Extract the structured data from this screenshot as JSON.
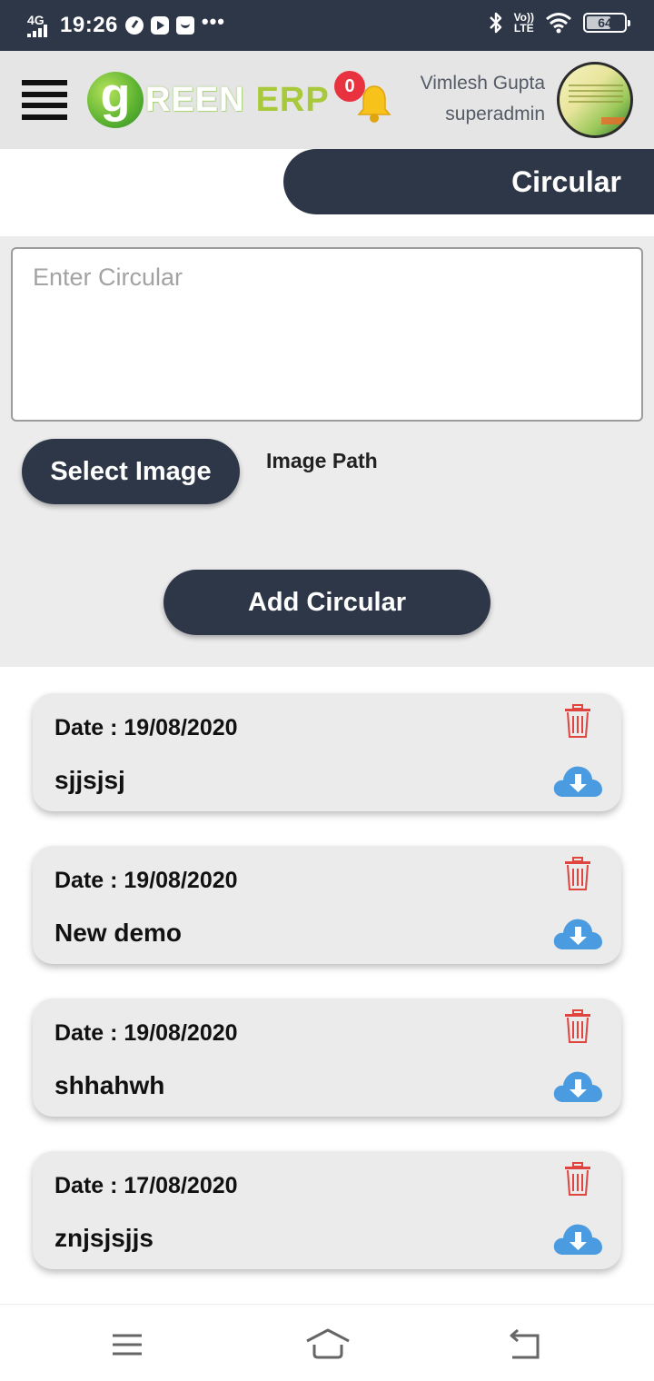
{
  "status_bar": {
    "network": "4G",
    "time": "19:26",
    "more": "•••",
    "volte_top": "Vo))",
    "volte_bottom": "LTE",
    "battery": "64",
    "battery_level_percent": 64
  },
  "header": {
    "logo_g": "g",
    "logo_reen": "REEN",
    "logo_erp": "ERP",
    "notification_count": "0",
    "user_name": "Vimlesh Gupta",
    "user_role": "superadmin"
  },
  "page": {
    "title": "Circular"
  },
  "form": {
    "circular_placeholder": "Enter Circular",
    "circular_value": "",
    "select_image_label": "Select Image",
    "image_path_label": "Image Path",
    "add_button_label": "Add Circular"
  },
  "circulars": [
    {
      "date": "Date : 19/08/2020",
      "title": "sjjsjsj"
    },
    {
      "date": "Date : 19/08/2020",
      "title": "New demo"
    },
    {
      "date": "Date : 19/08/2020",
      "title": "shhahwh"
    },
    {
      "date": "Date : 17/08/2020",
      "title": "znjsjsjjs"
    }
  ],
  "colors": {
    "primary_dark": "#2e3748",
    "badge_red": "#e8323f",
    "trash_red": "#e0443e",
    "download_blue": "#4a9be0",
    "logo_green": "#5bb130"
  },
  "icons": {
    "menu": "hamburger-icon",
    "bell": "bell-icon",
    "trash": "trash-icon",
    "download": "cloud-download-icon",
    "nav_recent": "recent-apps-icon",
    "nav_home": "home-icon",
    "nav_back": "back-icon"
  }
}
